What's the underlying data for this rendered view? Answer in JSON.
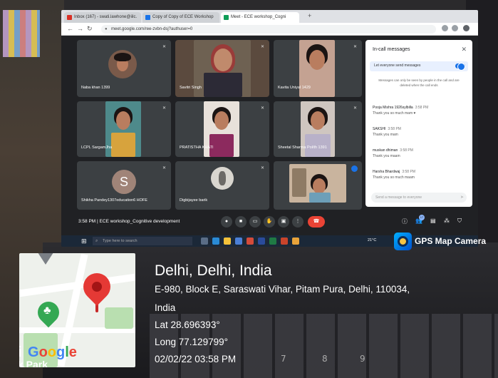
{
  "browser": {
    "tabs": [
      {
        "label": "Inbox (167) - swati.lawhone@iilc.",
        "icon_color": "#d93025"
      },
      {
        "label": "Copy of Copy of ECE Workshop",
        "icon_color": "#1a73e8"
      },
      {
        "label": "Meet - ECE workshop_Cogni",
        "icon_color": "#0f9d58"
      }
    ],
    "url": "meet.google.com/ree-zvbn-dsj?authuser=0"
  },
  "meet": {
    "tiles": [
      {
        "name": "Naba khan 1399"
      },
      {
        "name": "Savitri Singh"
      },
      {
        "name": "Kavita Uniyal 1429"
      },
      {
        "name": "LCPL SargamJha"
      },
      {
        "name": "PRATISTHA KHATI"
      },
      {
        "name": "Sheetal Sharma Pol/th 1391"
      },
      {
        "name": "Shikha Pandey1307education6 HOFE",
        "initial": "S"
      },
      {
        "name": "Digbijayee barik"
      },
      {
        "name": ""
      }
    ],
    "chat": {
      "title": "In-call messages",
      "toggle_label": "Let everyone send messages",
      "note": "Messages can only be seen by people in the call and are deleted when the call ends",
      "messages": [
        {
          "sender": "Pooja Mishra 1926sylbilla",
          "time": "3:58 PM",
          "text": "Thank you so much mam ♥"
        },
        {
          "sender": "SAKSHI",
          "time": "3:58 PM",
          "text": "Thank you mam"
        },
        {
          "sender": "muskan dhiman",
          "time": "3:58 PM",
          "text": "Thank you maam"
        },
        {
          "sender": "Harsha Bhardwaj",
          "time": "3:58 PM",
          "text": "Thank you so much maam"
        }
      ],
      "input_placeholder": "Send a message to everyone"
    },
    "bottom": {
      "time": "3:58 PM",
      "separator": "|",
      "meeting_name": "ECE workshop_Cognitive development",
      "participants_badge": "17"
    }
  },
  "taskbar": {
    "search_placeholder": "Type here to search",
    "weather": "21°C"
  },
  "overlay": {
    "app_label": "GPS Map Camera",
    "city": "Delhi, Delhi, India",
    "address_line1": "E-980, Block E, Saraswati Vihar, Pitam Pura, Delhi, 110034,",
    "address_line2": "India",
    "lat": "Lat 28.696393°",
    "long": "Long 77.129799°",
    "datetime": "02/02/22 03:58 PM",
    "map_logo_prefix": "i",
    "map_logo": "Google",
    "map_park": "k Park",
    "logo_colors": [
      "#4285f4",
      "#ea4335",
      "#fbbc05",
      "#4285f4",
      "#34a853",
      "#ea4335"
    ]
  },
  "keyboard_keys": [
    "7",
    "8",
    "9"
  ]
}
